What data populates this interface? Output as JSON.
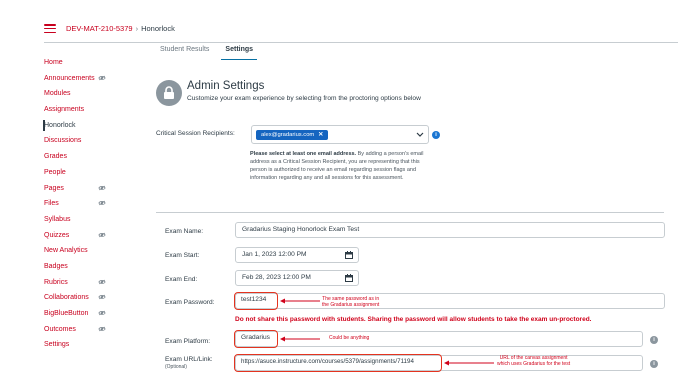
{
  "header": {
    "course": "DEV-MAT-210-5379",
    "separator": "›",
    "current": "Honorlock"
  },
  "sidebar": {
    "items": [
      {
        "label": "Home",
        "hidden": false
      },
      {
        "label": "Announcements",
        "hidden": true
      },
      {
        "label": "Modules",
        "hidden": false
      },
      {
        "label": "Assignments",
        "hidden": false
      },
      {
        "label": "Honorlock",
        "hidden": false,
        "active": true
      },
      {
        "label": "Discussions",
        "hidden": false
      },
      {
        "label": "Grades",
        "hidden": false
      },
      {
        "label": "People",
        "hidden": false
      },
      {
        "label": "Pages",
        "hidden": true
      },
      {
        "label": "Files",
        "hidden": true
      },
      {
        "label": "Syllabus",
        "hidden": false
      },
      {
        "label": "Quizzes",
        "hidden": true
      },
      {
        "label": "New Analytics",
        "hidden": false
      },
      {
        "label": "Badges",
        "hidden": false
      },
      {
        "label": "Rubrics",
        "hidden": true
      },
      {
        "label": "Collaborations",
        "hidden": true
      },
      {
        "label": "BigBlueButton",
        "hidden": true
      },
      {
        "label": "Outcomes",
        "hidden": true
      },
      {
        "label": "Settings",
        "hidden": false
      }
    ]
  },
  "tabs": [
    {
      "label": "Student Results",
      "active": false
    },
    {
      "label": "Settings",
      "active": true
    }
  ],
  "admin": {
    "title": "Admin Settings",
    "subtitle": "Customize your exam experience by selecting from the proctoring options below"
  },
  "critical": {
    "label": "Critical Session Recipients:",
    "chip": "alex@gradarius.com",
    "chip_remove": "✕",
    "help_bold": "Please select at least one email address.",
    "help_rest": " By adding a person's email address as a Critical Session Recipient, you are representing that this person is authorized to receive an email regarding session flags and information regarding any and all sessions for this assessment."
  },
  "form": {
    "exam_name_label": "Exam Name:",
    "exam_name_value": "Gradarius Staging Honorlock Exam Test",
    "exam_start_label": "Exam Start:",
    "exam_start_value": "Jan 1, 2023 12:00 PM",
    "exam_end_label": "Exam End:",
    "exam_end_value": "Feb 28, 2023 12:00 PM",
    "password_label": "Exam Password:",
    "password_value": "test1234",
    "password_warning": "Do not share this password with students. Sharing the password will allow students to take the exam un-proctored.",
    "platform_label": "Exam Platform:",
    "platform_value": "Gradarius",
    "url_label": "Exam URL/Link:",
    "url_optional": "(Optional)",
    "url_value": "https://asuce.instructure.com/courses/5379/assignments/71194"
  },
  "annotations": {
    "password_line1": "The same password as in",
    "password_line2": "the Gradarius assignment",
    "platform": "Could be anything",
    "url_line1": "URL of the canvas assignment",
    "url_line2": "which uses Gradarius for the test"
  },
  "colors": {
    "link": "#c8001e",
    "chip": "#1565c0",
    "annotation": "#d0021b",
    "tab_underline": "#0770a3"
  }
}
